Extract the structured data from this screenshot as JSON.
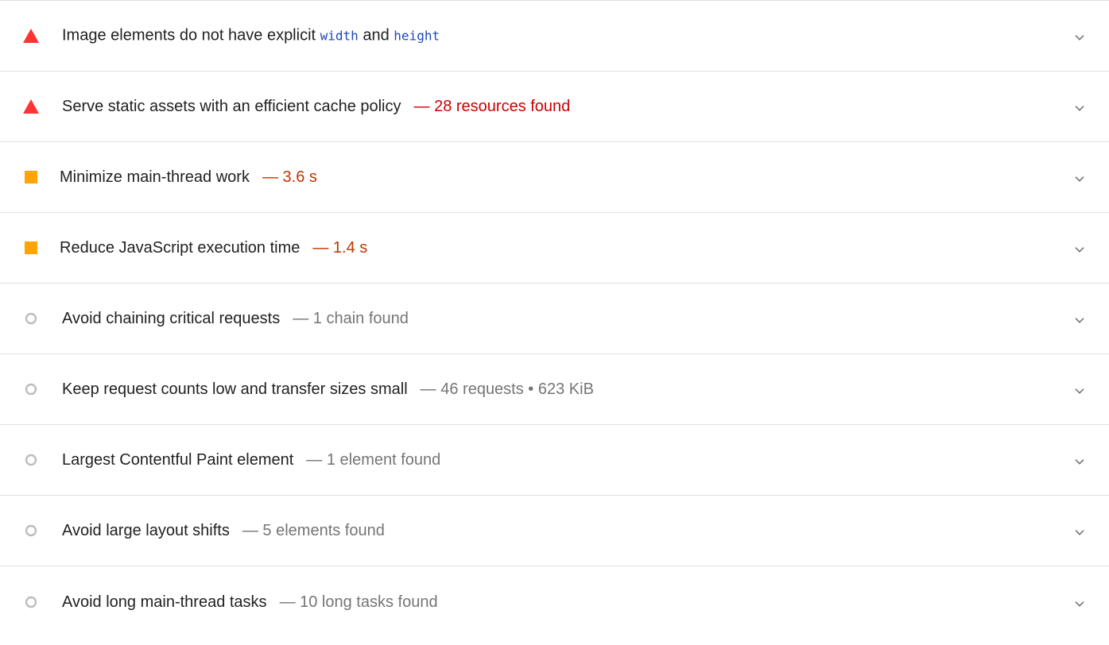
{
  "colors": {
    "fail": "#ff3333",
    "fail_text": "#cc0000",
    "average": "#ffa400",
    "average_text": "#c33300",
    "info": "#bdbdbd",
    "info_text": "#757575",
    "code": "#1a47b8"
  },
  "audits": [
    {
      "status": "fail",
      "icon": "warning-triangle-icon",
      "title_before": "Image elements do not have explicit ",
      "code1": "width",
      "title_mid": " and ",
      "code2": "height"
    },
    {
      "status": "fail",
      "icon": "warning-triangle-icon",
      "title": "Serve static assets with an efficient cache policy",
      "display": "— 28 resources found"
    },
    {
      "status": "average",
      "icon": "orange-square-icon",
      "title": "Minimize main-thread work",
      "display": "— 3.6 s"
    },
    {
      "status": "average",
      "icon": "orange-square-icon",
      "title": "Reduce JavaScript execution time",
      "display": "— 1.4 s"
    },
    {
      "status": "info",
      "icon": "info-circle-icon",
      "title": "Avoid chaining critical requests",
      "display": "— 1 chain found"
    },
    {
      "status": "info",
      "icon": "info-circle-icon",
      "title": "Keep request counts low and transfer sizes small",
      "display": "— 46 requests • 623 KiB"
    },
    {
      "status": "info",
      "icon": "info-circle-icon",
      "title": "Largest Contentful Paint element",
      "display": "— 1 element found"
    },
    {
      "status": "info",
      "icon": "info-circle-icon",
      "title": "Avoid large layout shifts",
      "display": "— 5 elements found"
    },
    {
      "status": "info",
      "icon": "info-circle-icon",
      "title": "Avoid long main-thread tasks",
      "display": "— 10 long tasks found"
    }
  ]
}
